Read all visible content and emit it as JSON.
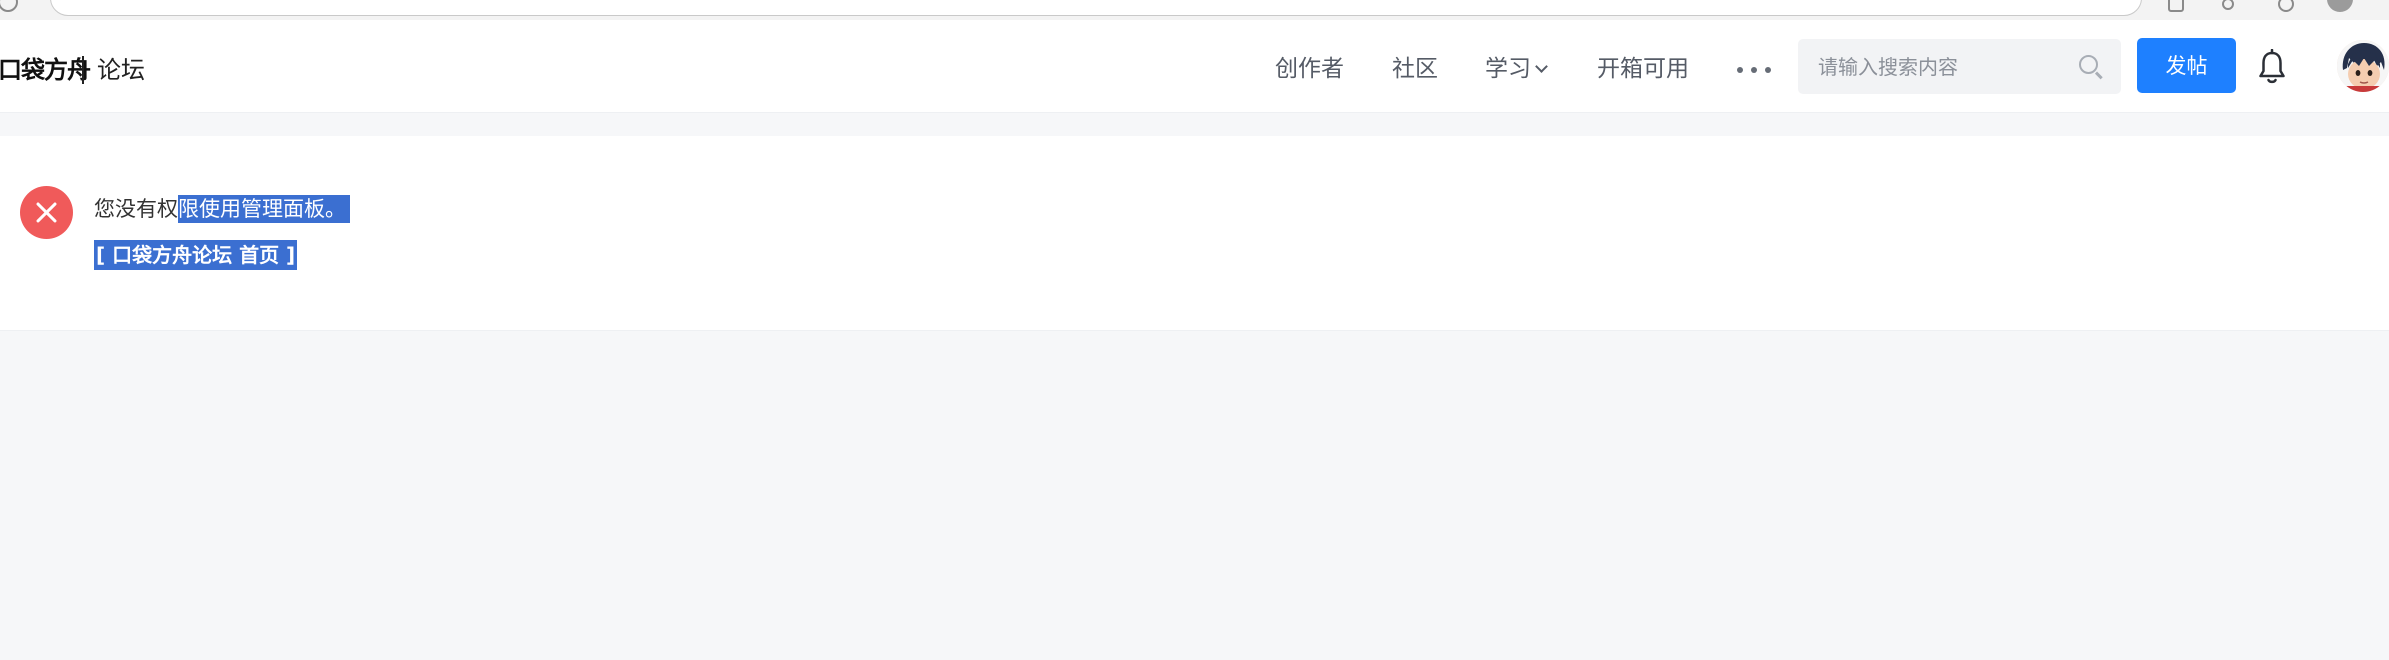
{
  "header": {
    "logo": "口袋方舟",
    "logo_sub": "论坛",
    "nav": {
      "creator": "创作者",
      "community": "社区",
      "learn": "学习",
      "unbox": "开箱可用"
    },
    "search": {
      "placeholder": "请输入搜索内容"
    },
    "post_button": "发帖"
  },
  "message": {
    "text_before": "您没有权",
    "text_selected": "限使用管理面板。",
    "home_link": "[ 口袋方舟论坛 首页 ]"
  },
  "colors": {
    "accent": "#1e80ff",
    "error": "#f05a5a",
    "selection": "#3b6fd1"
  }
}
